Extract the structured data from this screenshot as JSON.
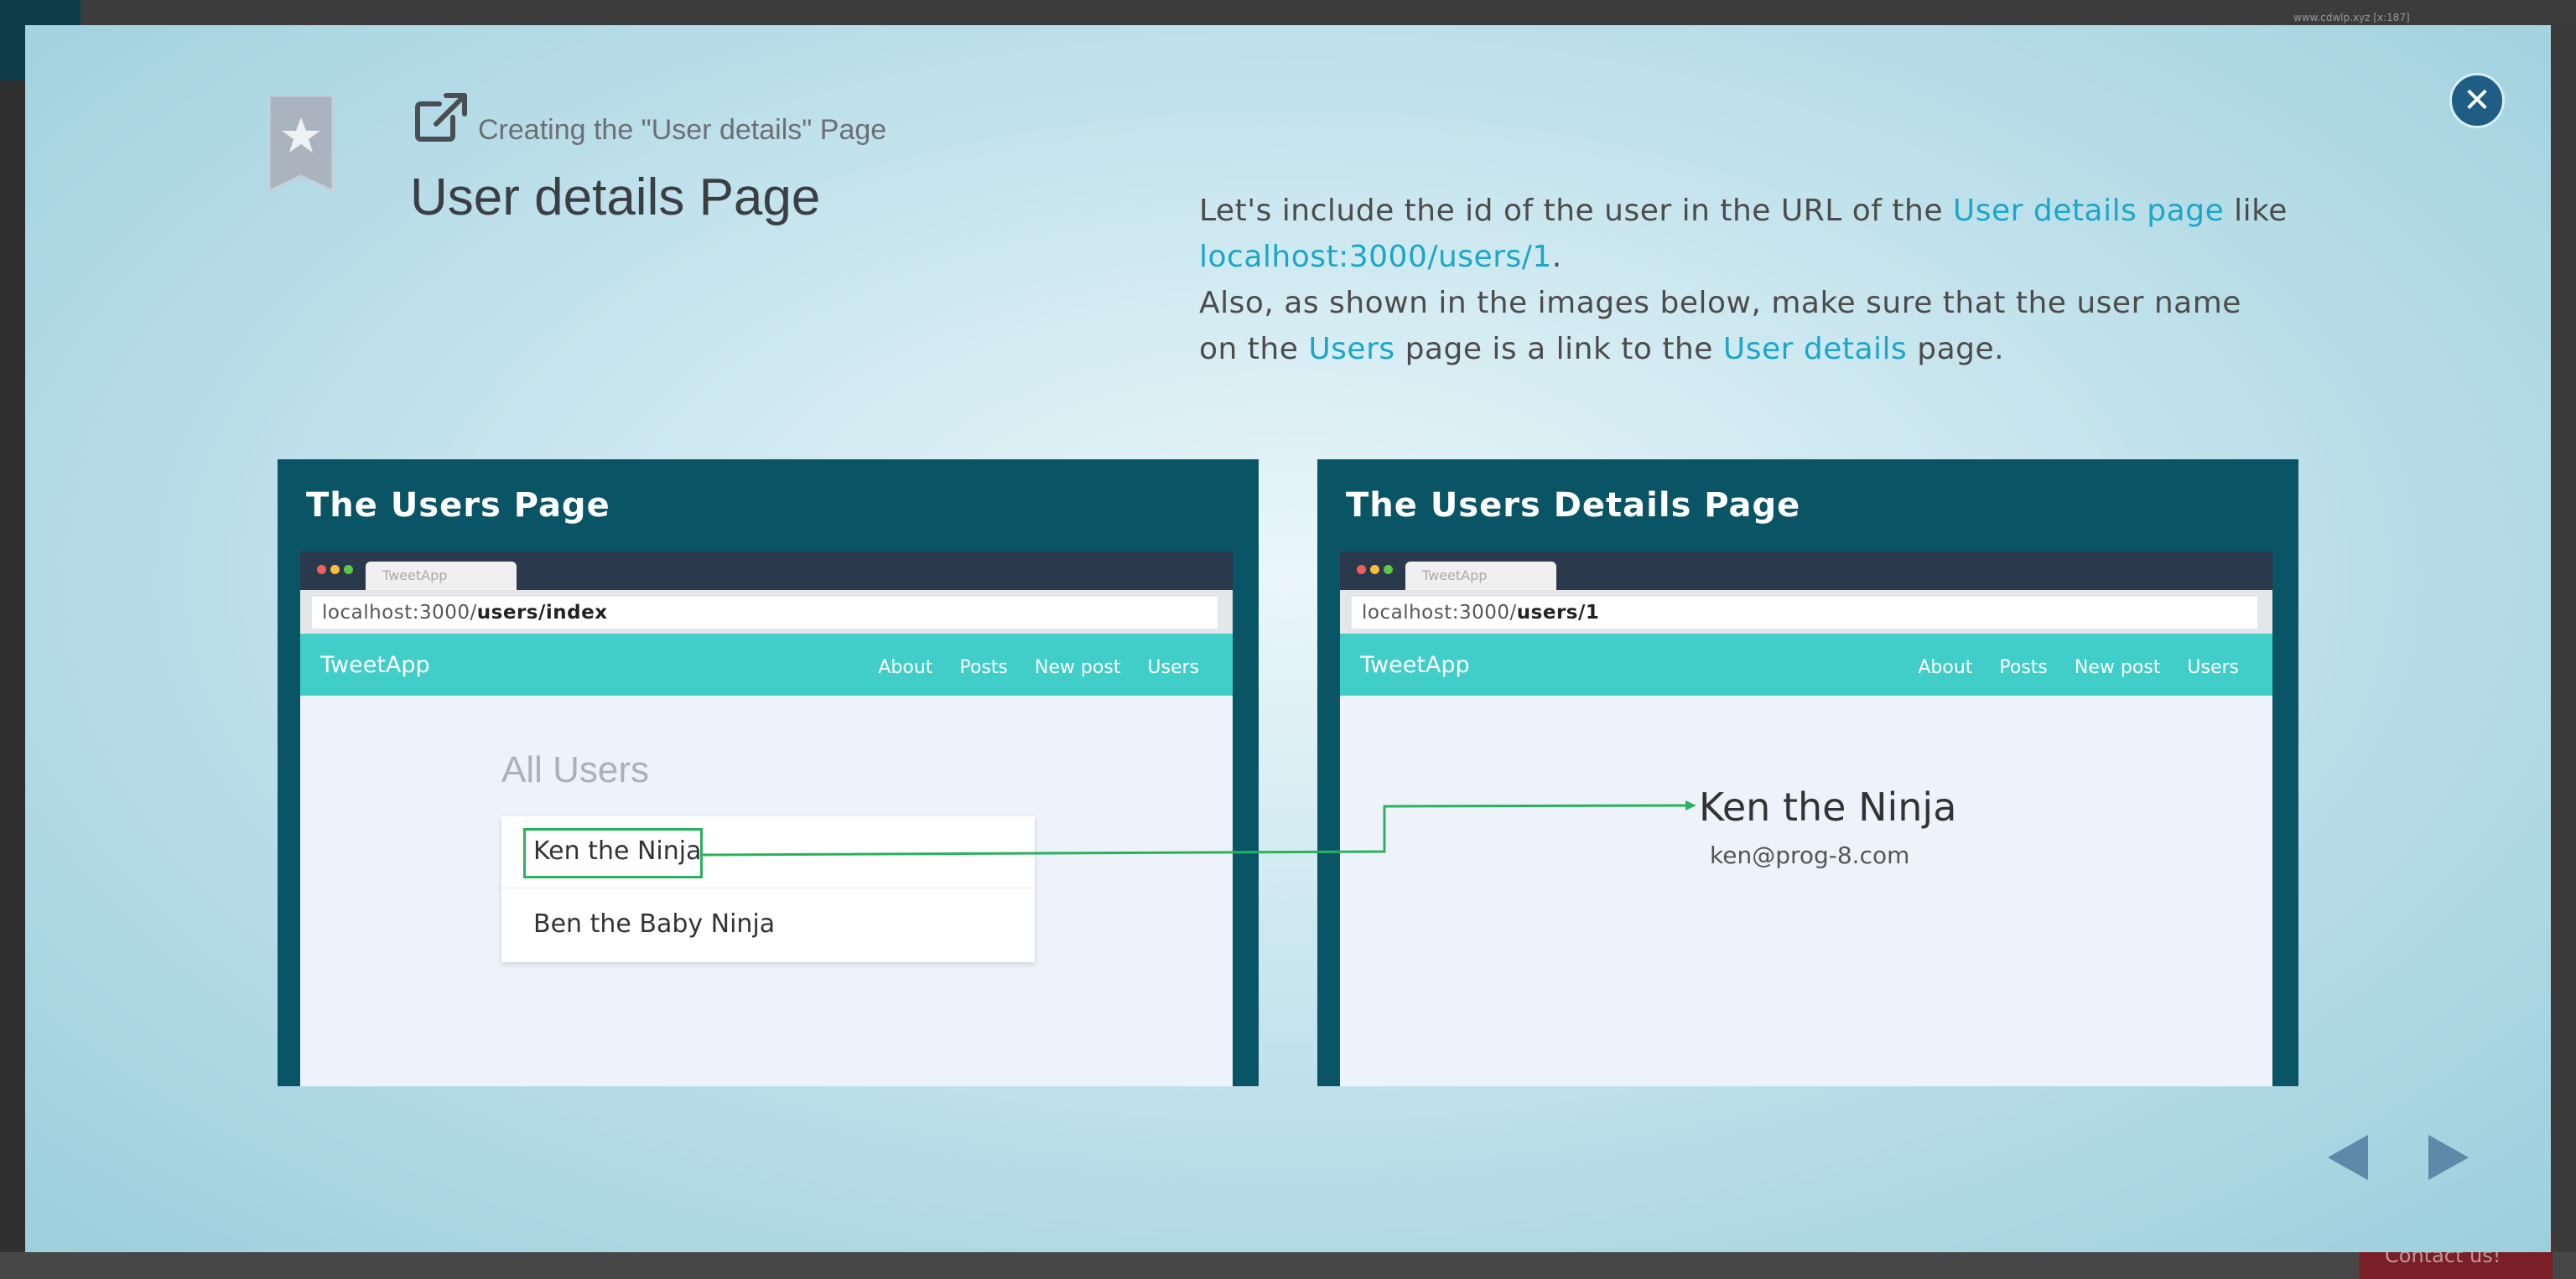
{
  "background": {
    "url_text": "www.cdwlp.xyz [x:187]",
    "contact_label": "Contact us!"
  },
  "modal": {
    "subtitle": "Creating the \"User details\" Page",
    "title": "User details Page",
    "close_icon": "close-icon",
    "description": {
      "p1_a": "Let's include the id of the user in the URL of the ",
      "p1_link1": "User details page",
      "p1_b": " like ",
      "p1_link2": "localhost:3000/users/1",
      "p1_c": ".",
      "p2_a": "Also, as shown in the images below, make sure that the user name on the ",
      "p2_link1": "Users",
      "p2_b": " page is a link to the ",
      "p2_link2": "User details",
      "p2_c": " page."
    }
  },
  "left_panel": {
    "title": "The Users Page",
    "tab_label": "TweetApp",
    "url_prefix": "localhost:3000/",
    "url_path": "users/index",
    "brand": "TweetApp",
    "nav": [
      "About",
      "Posts",
      "New post",
      "Users"
    ],
    "heading": "All Users",
    "users": [
      "Ken the Ninja",
      "Ben the Baby Ninja"
    ]
  },
  "right_panel": {
    "title": "The Users Details Page",
    "tab_label": "TweetApp",
    "url_prefix": "localhost:3000/",
    "url_path": "users/1",
    "brand": "TweetApp",
    "nav": [
      "About",
      "Posts",
      "New post",
      "Users"
    ],
    "user_name": "Ken the Ninja",
    "user_email": "ken@prog-8.com"
  },
  "colors": {
    "accent_link": "#1ba7c9",
    "panel_bg": "#0a5565",
    "navbar": "#41cdc8",
    "highlight": "#28b25c",
    "close_btn": "#1f5d84"
  }
}
